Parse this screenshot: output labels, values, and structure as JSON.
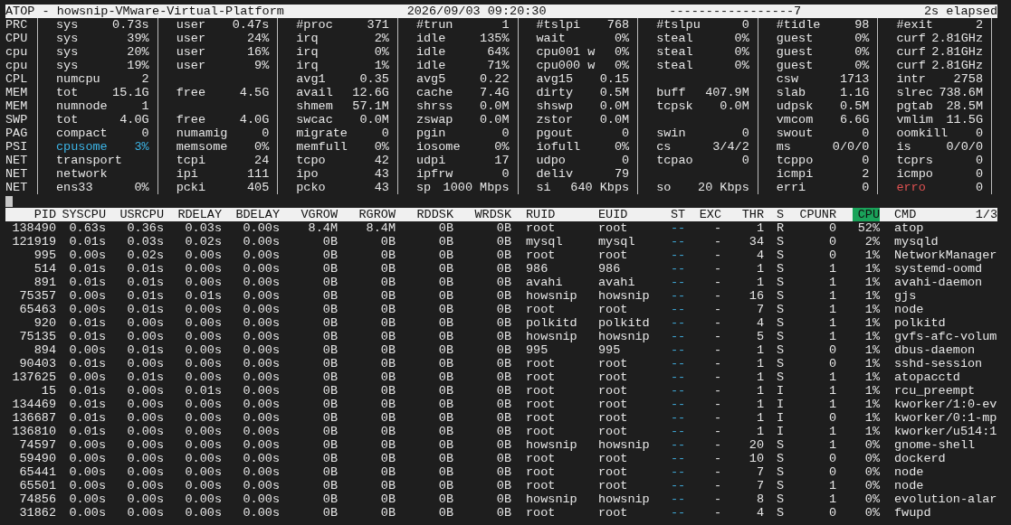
{
  "header": {
    "title": "ATOP - howsnip-VMware-Virtual-Platform",
    "datetime": "2026/09/03 09:20:30",
    "marker": "-----------------7",
    "elapsed": "2s elapsed"
  },
  "system_lines": [
    {
      "label": "PRC",
      "columns": {
        "column_1": {
          "name": "sys",
          "value": "0.73s"
        },
        "column_2": {
          "name": "user",
          "value": "0.47s"
        },
        "column_3": {
          "name": "#proc",
          "value": "371"
        },
        "column_4": {
          "name": "#trun",
          "value": "1"
        },
        "column_5": {
          "name": "#tslpi",
          "value": "768"
        },
        "column_6": {
          "name": "#tslpu",
          "value": "0"
        },
        "column_7": {
          "name": "#tidle",
          "value": "98"
        },
        "column_8": {
          "name": "#exit",
          "value": "2"
        }
      }
    },
    {
      "label": "CPU",
      "columns": {
        "column_1": {
          "name": "sys",
          "value": "39%"
        },
        "column_2": {
          "name": "user",
          "value": "24%"
        },
        "column_3": {
          "name": "irq",
          "value": "2%"
        },
        "column_4": {
          "name": "idle",
          "value": "135%"
        },
        "column_5": {
          "name": "wait",
          "value": "0%"
        },
        "column_6": {
          "name": "steal",
          "value": "0%"
        },
        "column_7": {
          "name": "guest",
          "value": "0%"
        },
        "column_8": {
          "name": "curf",
          "value": "2.81GHz"
        }
      }
    },
    {
      "label": "cpu",
      "columns": {
        "column_1": {
          "name": "sys",
          "value": "20%"
        },
        "column_2": {
          "name": "user",
          "value": "16%"
        },
        "column_3": {
          "name": "irq",
          "value": "0%"
        },
        "column_4": {
          "name": "idle",
          "value": "64%"
        },
        "column_5": {
          "name": "cpu001 w",
          "value": "0%"
        },
        "column_6": {
          "name": "steal",
          "value": "0%"
        },
        "column_7": {
          "name": "guest",
          "value": "0%"
        },
        "column_8": {
          "name": "curf",
          "value": "2.81GHz"
        }
      }
    },
    {
      "label": "cpu",
      "columns": {
        "column_1": {
          "name": "sys",
          "value": "19%"
        },
        "column_2": {
          "name": "user",
          "value": "9%"
        },
        "column_3": {
          "name": "irq",
          "value": "1%"
        },
        "column_4": {
          "name": "idle",
          "value": "71%"
        },
        "column_5": {
          "name": "cpu000 w",
          "value": "0%"
        },
        "column_6": {
          "name": "steal",
          "value": "0%"
        },
        "column_7": {
          "name": "guest",
          "value": "0%"
        },
        "column_8": {
          "name": "curf",
          "value": "2.81GHz"
        }
      }
    },
    {
      "label": "CPL",
      "columns": {
        "column_1": {
          "name": "numcpu",
          "value": "2"
        },
        "column_3": {
          "name": "avg1",
          "value": "0.35"
        },
        "column_4": {
          "name": "avg5",
          "value": "0.22"
        },
        "column_5": {
          "name": "avg15",
          "value": "0.15"
        },
        "column_7": {
          "name": "csw",
          "value": "1713"
        },
        "column_8": {
          "name": "intr",
          "value": "2758"
        }
      }
    },
    {
      "label": "MEM",
      "columns": {
        "column_1": {
          "name": "tot",
          "value": "15.1G"
        },
        "column_2": {
          "name": "free",
          "value": "4.5G"
        },
        "column_3": {
          "name": "avail",
          "value": "12.6G"
        },
        "column_4": {
          "name": "cache",
          "value": "7.4G"
        },
        "column_5": {
          "name": "dirty",
          "value": "0.5M"
        },
        "column_6": {
          "name": "buff",
          "value": "407.9M"
        },
        "column_7": {
          "name": "slab",
          "value": "1.1G"
        },
        "column_8": {
          "name": "slrec",
          "value": "738.6M"
        }
      }
    },
    {
      "label": "MEM",
      "columns": {
        "column_1": {
          "name": "numnode",
          "value": "1"
        },
        "column_3": {
          "name": "shmem",
          "value": "57.1M"
        },
        "column_4": {
          "name": "shrss",
          "value": "0.0M"
        },
        "column_5": {
          "name": "shswp",
          "value": "0.0M"
        },
        "column_6": {
          "name": "tcpsk",
          "value": "0.0M"
        },
        "column_7": {
          "name": "udpsk",
          "value": "0.5M"
        },
        "column_8": {
          "name": "pgtab",
          "value": "28.5M"
        }
      }
    },
    {
      "label": "SWP",
      "columns": {
        "column_1": {
          "name": "tot",
          "value": "4.0G"
        },
        "column_2": {
          "name": "free",
          "value": "4.0G"
        },
        "column_3": {
          "name": "swcac",
          "value": "0.0M"
        },
        "column_4": {
          "name": "zswap",
          "value": "0.0M"
        },
        "column_5": {
          "name": "zstor",
          "value": "0.0M"
        },
        "column_7": {
          "name": "vmcom",
          "value": "6.6G"
        },
        "column_8": {
          "name": "vmlim",
          "value": "11.5G"
        }
      }
    },
    {
      "label": "PAG",
      "columns": {
        "column_1": {
          "name": "compact",
          "value": "0"
        },
        "column_2": {
          "name": "numamig",
          "value": "0"
        },
        "column_3": {
          "name": "migrate",
          "value": "0"
        },
        "column_4": {
          "name": "pgin",
          "value": "0"
        },
        "column_5": {
          "name": "pgout",
          "value": "0"
        },
        "column_6": {
          "name": "swin",
          "value": "0"
        },
        "column_7": {
          "name": "swout",
          "value": "0"
        },
        "column_8": {
          "name": "oomkill",
          "value": "0"
        }
      }
    },
    {
      "label": "PSI",
      "columns": {
        "column_1": {
          "name": "cpusome",
          "value": "3%",
          "color": "#3cb4e6",
          "value_highlighted": true
        },
        "column_2": {
          "name": "memsome",
          "value": "0%"
        },
        "column_3": {
          "name": "memfull",
          "value": "0%"
        },
        "column_4": {
          "name": "iosome",
          "value": "0%"
        },
        "column_5": {
          "name": "iofull",
          "value": "0%"
        },
        "column_6": {
          "name": "cs",
          "value": "3/4/2"
        },
        "column_7": {
          "name": "ms",
          "value": "0/0/0"
        },
        "column_8": {
          "name": "is",
          "value": "0/0/0"
        }
      }
    },
    {
      "label": "NET",
      "columns": {
        "column_1": {
          "name": "transport"
        },
        "column_2": {
          "name": "tcpi",
          "value": "24"
        },
        "column_3": {
          "name": "tcpo",
          "value": "42"
        },
        "column_4": {
          "name": "udpi",
          "value": "17"
        },
        "column_5": {
          "name": "udpo",
          "value": "0"
        },
        "column_6": {
          "name": "tcpao",
          "value": "0"
        },
        "column_7": {
          "name": "tcppo",
          "value": "0"
        },
        "column_8": {
          "name": "tcprs",
          "value": "0"
        }
      }
    },
    {
      "label": "NET",
      "columns": {
        "column_1": {
          "name": "network"
        },
        "column_2": {
          "name": "ipi",
          "value": "111"
        },
        "column_3": {
          "name": "ipo",
          "value": "43"
        },
        "column_4": {
          "name": "ipfrw",
          "value": "0"
        },
        "column_5": {
          "name": "deliv",
          "value": "79"
        },
        "column_7": {
          "name": "icmpi",
          "value": "2"
        },
        "column_8": {
          "name": "icmpo",
          "value": "0"
        }
      }
    },
    {
      "label": "NET",
      "columns": {
        "column_1": {
          "name": "ens33",
          "value": "0%"
        },
        "column_2": {
          "name": "pcki",
          "value": "405"
        },
        "column_3": {
          "name": "pcko",
          "value": "43"
        },
        "column_4": {
          "name": "sp",
          "value": "1000 Mbps"
        },
        "column_5": {
          "name": "si",
          "value": "640 Kbps"
        },
        "column_6": {
          "name": "so",
          "value": "20 Kbps"
        },
        "column_7": {
          "name": "erri",
          "value": "0"
        },
        "column_8": {
          "name": "erro",
          "value": "0",
          "color": "#e05252"
        }
      }
    }
  ],
  "process_table": {
    "page": "1/3",
    "columns": [
      {
        "label": "PID",
        "sorted": false
      },
      {
        "label": "SYSCPU",
        "sorted": false
      },
      {
        "label": "USRCPU",
        "sorted": false
      },
      {
        "label": "RDELAY",
        "sorted": false
      },
      {
        "label": "BDELAY",
        "sorted": false
      },
      {
        "label": "VGROW",
        "sorted": false
      },
      {
        "label": "RGROW",
        "sorted": false
      },
      {
        "label": "RDDSK",
        "sorted": false
      },
      {
        "label": "WRDSK",
        "sorted": false
      },
      {
        "label": "RUID",
        "sorted": false
      },
      {
        "label": "EUID",
        "sorted": false
      },
      {
        "label": "ST",
        "sorted": false
      },
      {
        "label": "EXC",
        "sorted": false
      },
      {
        "label": "THR",
        "sorted": false
      },
      {
        "label": "S",
        "sorted": false
      },
      {
        "label": "CPUNR",
        "sorted": false
      },
      {
        "label": "CPU",
        "sorted": true
      },
      {
        "label": "CMD",
        "sorted": false
      }
    ],
    "rows": [
      [
        "138490",
        "0.63s",
        "0.36s",
        "0.03s",
        "0.00s",
        "8.4M",
        "8.4M",
        "0B",
        "0B",
        "root",
        "root",
        "--",
        "-",
        "1",
        "R",
        "0",
        "52%",
        "atop"
      ],
      [
        "121919",
        "0.01s",
        "0.03s",
        "0.02s",
        "0.00s",
        "0B",
        "0B",
        "0B",
        "0B",
        "mysql",
        "mysql",
        "--",
        "-",
        "34",
        "S",
        "0",
        "2%",
        "mysqld"
      ],
      [
        "995",
        "0.00s",
        "0.02s",
        "0.00s",
        "0.00s",
        "0B",
        "0B",
        "0B",
        "0B",
        "root",
        "root",
        "--",
        "-",
        "4",
        "S",
        "0",
        "1%",
        "NetworkManager"
      ],
      [
        "514",
        "0.01s",
        "0.01s",
        "0.00s",
        "0.00s",
        "0B",
        "0B",
        "0B",
        "0B",
        "986",
        "986",
        "--",
        "-",
        "1",
        "S",
        "1",
        "1%",
        "systemd-oomd"
      ],
      [
        "891",
        "0.01s",
        "0.01s",
        "0.00s",
        "0.00s",
        "0B",
        "0B",
        "0B",
        "0B",
        "avahi",
        "avahi",
        "--",
        "-",
        "1",
        "S",
        "1",
        "1%",
        "avahi-daemon"
      ],
      [
        "75357",
        "0.00s",
        "0.01s",
        "0.01s",
        "0.00s",
        "0B",
        "0B",
        "0B",
        "0B",
        "howsnip",
        "howsnip",
        "--",
        "-",
        "16",
        "S",
        "1",
        "1%",
        "gjs"
      ],
      [
        "65463",
        "0.00s",
        "0.01s",
        "0.00s",
        "0.00s",
        "0B",
        "0B",
        "0B",
        "0B",
        "root",
        "root",
        "--",
        "-",
        "7",
        "S",
        "1",
        "1%",
        "node"
      ],
      [
        "920",
        "0.01s",
        "0.00s",
        "0.00s",
        "0.00s",
        "0B",
        "0B",
        "0B",
        "0B",
        "polkitd",
        "polkitd",
        "--",
        "-",
        "4",
        "S",
        "1",
        "1%",
        "polkitd"
      ],
      [
        "75135",
        "0.01s",
        "0.00s",
        "0.00s",
        "0.00s",
        "0B",
        "0B",
        "0B",
        "0B",
        "howsnip",
        "howsnip",
        "--",
        "-",
        "5",
        "S",
        "1",
        "1%",
        "gvfs-afc-volum"
      ],
      [
        "894",
        "0.00s",
        "0.01s",
        "0.00s",
        "0.00s",
        "0B",
        "0B",
        "0B",
        "0B",
        "995",
        "995",
        "--",
        "-",
        "1",
        "S",
        "0",
        "1%",
        "dbus-daemon"
      ],
      [
        "90403",
        "0.01s",
        "0.00s",
        "0.00s",
        "0.00s",
        "0B",
        "0B",
        "0B",
        "0B",
        "root",
        "root",
        "--",
        "-",
        "1",
        "S",
        "0",
        "1%",
        "sshd-session"
      ],
      [
        "137625",
        "0.00s",
        "0.01s",
        "0.00s",
        "0.00s",
        "0B",
        "0B",
        "0B",
        "0B",
        "root",
        "root",
        "--",
        "-",
        "1",
        "S",
        "1",
        "1%",
        "atopacctd"
      ],
      [
        "15",
        "0.01s",
        "0.00s",
        "0.01s",
        "0.00s",
        "0B",
        "0B",
        "0B",
        "0B",
        "root",
        "root",
        "--",
        "-",
        "1",
        "I",
        "1",
        "1%",
        "rcu_preempt"
      ],
      [
        "134469",
        "0.01s",
        "0.00s",
        "0.00s",
        "0.00s",
        "0B",
        "0B",
        "0B",
        "0B",
        "root",
        "root",
        "--",
        "-",
        "1",
        "I",
        "1",
        "1%",
        "kworker/1:0-ev"
      ],
      [
        "136687",
        "0.01s",
        "0.00s",
        "0.00s",
        "0.00s",
        "0B",
        "0B",
        "0B",
        "0B",
        "root",
        "root",
        "--",
        "-",
        "1",
        "I",
        "0",
        "1%",
        "kworker/0:1-mp"
      ],
      [
        "136810",
        "0.01s",
        "0.00s",
        "0.00s",
        "0.00s",
        "0B",
        "0B",
        "0B",
        "0B",
        "root",
        "root",
        "--",
        "-",
        "1",
        "I",
        "1",
        "1%",
        "kworker/u514:1"
      ],
      [
        "74597",
        "0.00s",
        "0.00s",
        "0.00s",
        "0.00s",
        "0B",
        "0B",
        "0B",
        "0B",
        "howsnip",
        "howsnip",
        "--",
        "-",
        "20",
        "S",
        "1",
        "0%",
        "gnome-shell"
      ],
      [
        "59490",
        "0.00s",
        "0.00s",
        "0.00s",
        "0.00s",
        "0B",
        "0B",
        "0B",
        "0B",
        "root",
        "root",
        "--",
        "-",
        "10",
        "S",
        "0",
        "0%",
        "dockerd"
      ],
      [
        "65441",
        "0.00s",
        "0.00s",
        "0.00s",
        "0.00s",
        "0B",
        "0B",
        "0B",
        "0B",
        "root",
        "root",
        "--",
        "-",
        "7",
        "S",
        "0",
        "0%",
        "node"
      ],
      [
        "65501",
        "0.00s",
        "0.00s",
        "0.00s",
        "0.00s",
        "0B",
        "0B",
        "0B",
        "0B",
        "root",
        "root",
        "--",
        "-",
        "7",
        "S",
        "1",
        "0%",
        "node"
      ],
      [
        "74856",
        "0.00s",
        "0.00s",
        "0.00s",
        "0.00s",
        "0B",
        "0B",
        "0B",
        "0B",
        "howsnip",
        "howsnip",
        "--",
        "-",
        "8",
        "S",
        "1",
        "0%",
        "evolution-alar"
      ],
      [
        "31862",
        "0.00s",
        "0.00s",
        "0.00s",
        "0.00s",
        "0B",
        "0B",
        "0B",
        "0B",
        "root",
        "root",
        "--",
        "-",
        "4",
        "S",
        "0",
        "0%",
        "fwupd"
      ]
    ]
  }
}
